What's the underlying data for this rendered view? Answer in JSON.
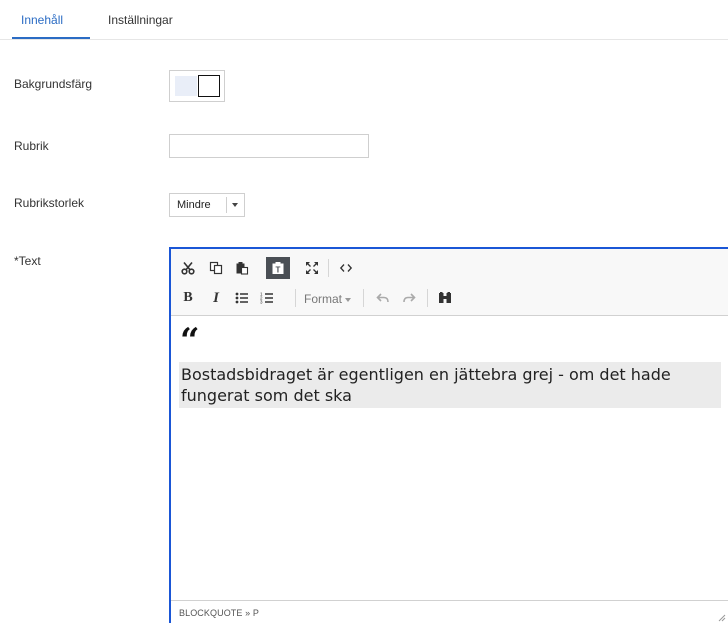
{
  "tabs": [
    {
      "label": "Innehåll",
      "active": true
    },
    {
      "label": "Inställningar",
      "active": false
    }
  ],
  "fields": {
    "background_color": {
      "label": "Bakgrundsfärg",
      "swatches": [
        "#e9eef8",
        "#ffffff"
      ]
    },
    "heading": {
      "label": "Rubrik",
      "value": "",
      "placeholder": ""
    },
    "heading_size": {
      "label": "Rubrikstorlek",
      "selected": "Mindre"
    },
    "text": {
      "label": "*Text"
    }
  },
  "editor": {
    "toolbar_row1": [
      "cut-icon",
      "copy-icon",
      "paste-icon",
      "paste-text-icon",
      "maximize-icon",
      "source-code-icon"
    ],
    "toolbar_row2": [
      "bold-icon",
      "italic-icon",
      "bulleted-list-icon",
      "numbered-list-icon",
      "format-dropdown",
      "undo-icon",
      "redo-icon",
      "find-icon"
    ],
    "format_label": "Format",
    "quote_mark": "“",
    "quote_text": "Bostadsbidraget är egentligen en jättebra grej - om det hade fungerat som det ska",
    "element_path": "BLOCKQUOTE » P"
  },
  "colors": {
    "accent": "#2b6cc4",
    "editor_border": "#1a56d6",
    "highlight": "#ebebeb"
  }
}
